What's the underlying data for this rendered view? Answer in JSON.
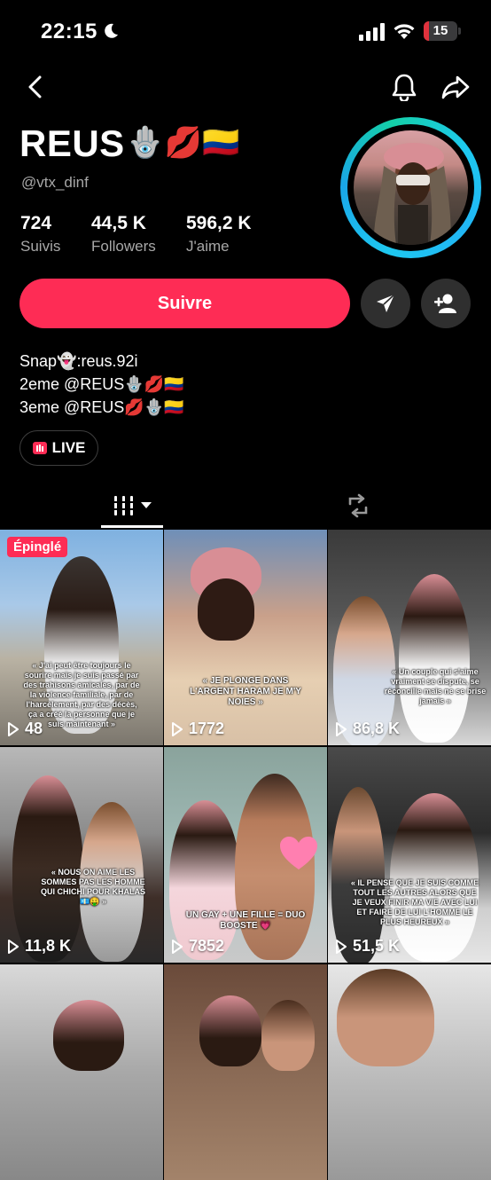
{
  "status_bar": {
    "time": "22:15",
    "battery": "15",
    "battery_level": 0.15,
    "battery_color": "#e0323d"
  },
  "profile": {
    "display_name": "REUS",
    "display_name_emojis": "🪬💋🇨🇴",
    "username": "@vtx_dinf",
    "stats": [
      {
        "value": "724",
        "label": "Suivis"
      },
      {
        "value": "44,5 K",
        "label": "Followers"
      },
      {
        "value": "596,2 K",
        "label": "J'aime"
      }
    ]
  },
  "actions": {
    "follow_label": "Suivre",
    "accent_color": "#fe2c55"
  },
  "bio": {
    "lines": [
      "Snap👻:reus.92i",
      "2eme @REUS🪬💋🇨🇴",
      "3eme @REUS💋🪬🇨🇴"
    ]
  },
  "live_chip": {
    "label": "LIVE"
  },
  "videos": [
    {
      "pinned_label": "Épinglé",
      "views": "48",
      "caption": "« J'ai peut être toujours le sourire mais je suis passé par des trahisons amicales, par de la violence familiale, par de l'harcèlement, par des décès, ça a créé la personne que je suis maintenant »"
    },
    {
      "views": "1772",
      "caption": "« JE PLONGE DANS L'ARGENT HARAM JE M'Y NOIES »"
    },
    {
      "views": "86,8 K",
      "caption": "« Un couple qui s'aime vraiment se dispute, se réconcilie mais ne se brise jamais »"
    },
    {
      "views": "11,8 K",
      "caption": "« NOUS ON AIME LES SOMMES PAS LES HOMME QUI CHICHI POUR KHALAS 💶🤑 »"
    },
    {
      "views": "7852",
      "caption": "UN GAY + UNE FILLE = DUO BOOSTE 💗"
    },
    {
      "views": "51,5 K",
      "caption": "« IL PENSE QUE JE SUIS COMME TOUT LES AUTRES ALORS QUE JE VEUX FINIR MA VIE AVEC LUI ET FAIRE DE LUI L'HOMME LE PLUS HEUREUX »"
    },
    {
      "views": "",
      "caption": ""
    },
    {
      "views": "",
      "caption": ""
    },
    {
      "views": "",
      "caption": ""
    }
  ]
}
